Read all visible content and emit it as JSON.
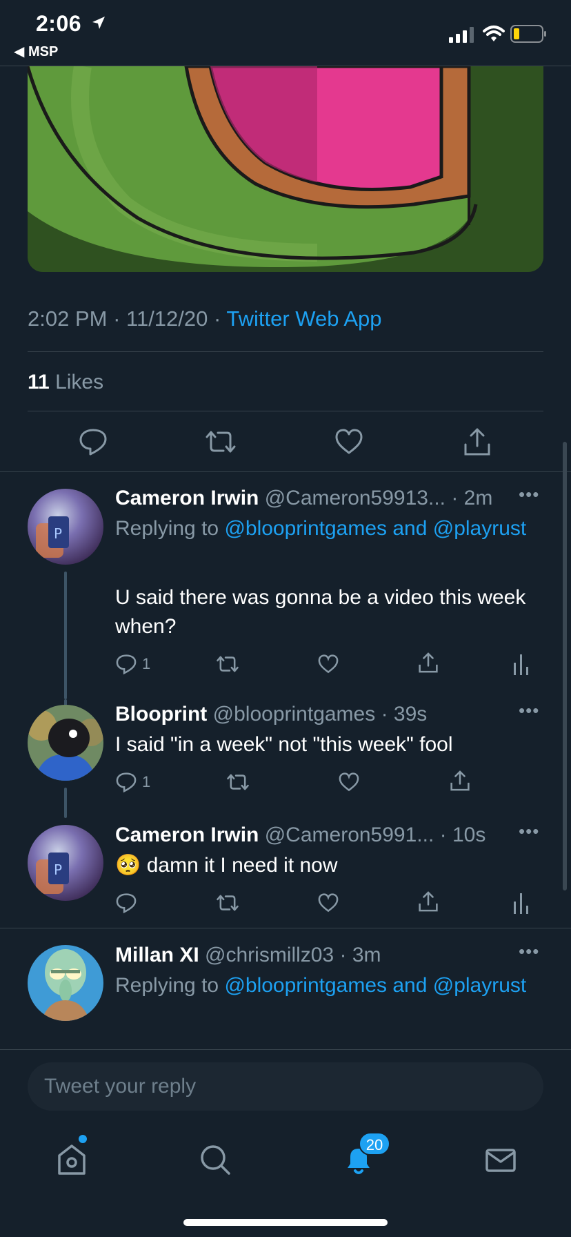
{
  "status_bar": {
    "time": "2:06",
    "back_app": "◀ MSP"
  },
  "tweet_main": {
    "time": "2:02 PM",
    "date": "11/12/20",
    "source": "Twitter Web App",
    "likes_count": "11",
    "likes_label": "Likes"
  },
  "replies": [
    {
      "name": "Cameron Irwin",
      "handle": "@Cameron59913...",
      "time": "2m",
      "replying_to_prefix": "Replying to",
      "replying_to_mentions": "@blooprintgames and @playrust",
      "text": "U said there was gonna be a video this week when?",
      "reply_count": "1"
    },
    {
      "name": "Blooprint",
      "handle": "@blooprintgames",
      "time": "39s",
      "text": "I said \"in a week\" not \"this week\" fool",
      "reply_count": "1"
    },
    {
      "name": "Cameron Irwin",
      "handle": "@Cameron5991...",
      "time": "10s",
      "emoji": "🥺",
      "text": "damn it I need it now"
    },
    {
      "name": "Millan XI",
      "handle": "@chrismillz03",
      "time": "3m",
      "replying_to_prefix": "Replying to",
      "replying_to_mentions": "@blooprintgames and @playrust"
    }
  ],
  "reply_bar": {
    "placeholder": "Tweet your reply"
  },
  "tab_bar": {
    "notifications_badge": "20"
  },
  "colors": {
    "background": "#15202b",
    "accent": "#1da1f2",
    "muted": "#8899a6",
    "divider": "#38444d"
  }
}
